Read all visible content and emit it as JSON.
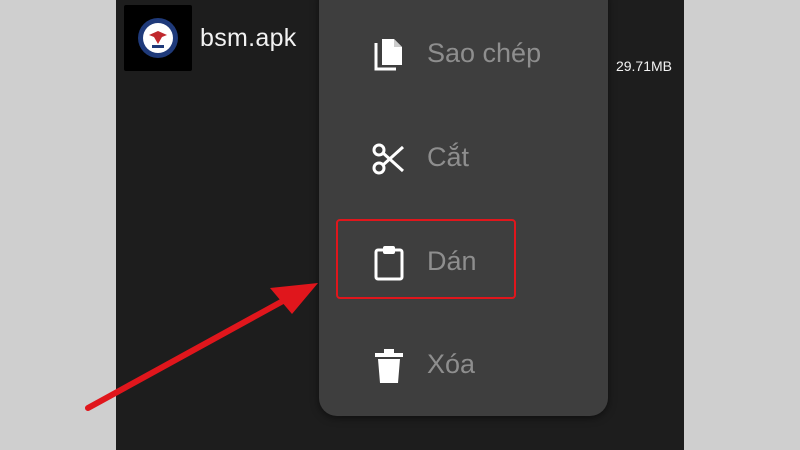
{
  "file": {
    "name": "bsm.apk",
    "size": "29.71MB",
    "thumbnail_icon": "app-logo-icon"
  },
  "context_menu": {
    "items": [
      {
        "label": "Sao chép",
        "icon": "copy-icon"
      },
      {
        "label": "Cắt",
        "icon": "cut-icon"
      },
      {
        "label": "Dán",
        "icon": "paste-icon"
      },
      {
        "label": "Xóa",
        "icon": "delete-icon"
      }
    ]
  },
  "annotation": {
    "highlight_color": "#e0161c",
    "highlighted_item": "Dán"
  },
  "colors": {
    "background": "#cfcfcf",
    "screen": "#1d1d1d",
    "menu": "#3e3e3e",
    "menu_text": "#8e8e8e",
    "icon": "#ffffff"
  }
}
